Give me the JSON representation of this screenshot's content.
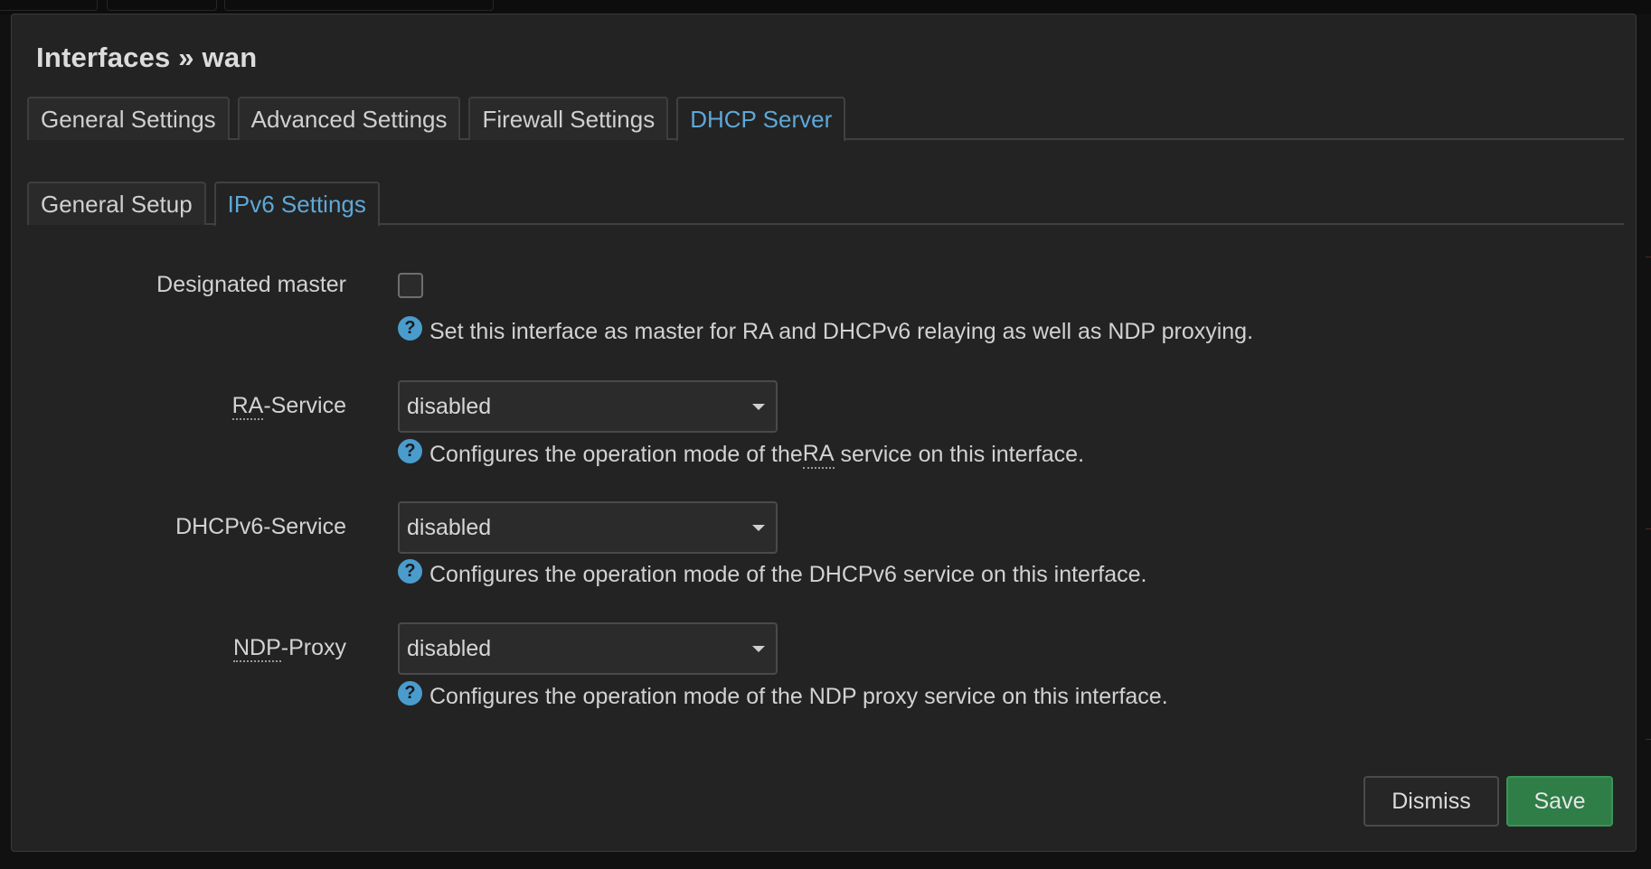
{
  "modal": {
    "title": "Interfaces » wan"
  },
  "main_tabs": [
    {
      "label": "General Settings",
      "active": false
    },
    {
      "label": "Advanced Settings",
      "active": false
    },
    {
      "label": "Firewall Settings",
      "active": false
    },
    {
      "label": "DHCP Server",
      "active": true
    }
  ],
  "sub_tabs": [
    {
      "label": "General Setup",
      "active": false
    },
    {
      "label": "IPv6 Settings",
      "active": true
    }
  ],
  "fields": {
    "designated_master": {
      "label": "Designated master",
      "checked": false,
      "help": "Set this interface as master for RA and DHCPv6 relaying as well as NDP proxying."
    },
    "ra_service": {
      "label_abbr": "RA",
      "label_rest": "-Service",
      "value": "disabled",
      "help_pre": "Configures the operation mode of the ",
      "help_abbr": "RA",
      "help_post": " service on this interface."
    },
    "dhcpv6_service": {
      "label": "DHCPv6-Service",
      "value": "disabled",
      "help": "Configures the operation mode of the DHCPv6 service on this interface."
    },
    "ndp_proxy": {
      "label_abbr": "NDP",
      "label_rest": "-Proxy",
      "value": "disabled",
      "help": "Configures the operation mode of the NDP proxy service on this interface."
    }
  },
  "help_icon_glyph": "?",
  "buttons": {
    "dismiss": "Dismiss",
    "save": "Save"
  },
  "colors": {
    "accent": "#5da8d8",
    "save": "#2f7d47",
    "background": "#232323"
  }
}
